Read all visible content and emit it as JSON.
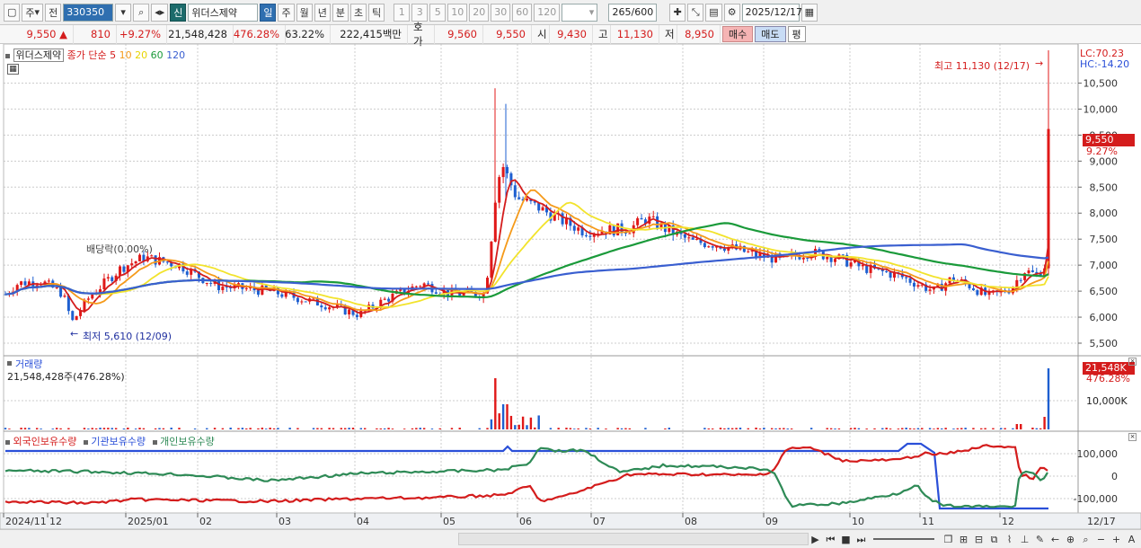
{
  "toolbar": {
    "market": "주",
    "prev": "전",
    "code": "330350",
    "name_badge": "신",
    "name": "위더스제약",
    "periods": [
      "일",
      "주",
      "월",
      "년",
      "분",
      "초",
      "틱"
    ],
    "intervals": [
      "1",
      "3",
      "5",
      "10",
      "20",
      "30",
      "60",
      "120"
    ],
    "count": "265",
    "count_total": "/600",
    "date": "2025/12/17"
  },
  "quote": {
    "price": "9,550",
    "change": "810",
    "change_pct": "+9.27%",
    "volume": "21,548,428",
    "vol_ratio": "476.28%",
    "turnover": "63.22%",
    "amount": "222,415백만",
    "bid_label": "호가",
    "ask": "9,560",
    "bid": "9,550",
    "open_label": "시",
    "open": "9,430",
    "high_label": "고",
    "high": "11,130",
    "low_label": "저",
    "low": "8,950",
    "buy": "매수",
    "sell": "매도",
    "eval": "평"
  },
  "legend": {
    "stock": "위더스제약",
    "ma_label": "종가 단순",
    "ma": [
      {
        "p": "5",
        "color": "#d41c1c"
      },
      {
        "p": "10",
        "color": "#f59a1a"
      },
      {
        "p": "20",
        "color": "#f2e32c"
      },
      {
        "p": "60",
        "color": "#1a9a3a"
      },
      {
        "p": "120",
        "color": "#3a5fd0"
      }
    ]
  },
  "annotations": {
    "high": "최고 11,130 (12/17)",
    "low": "최저 5,610 (12/09)",
    "dividend": "배당락(0.00%)",
    "lc": "LC:70.23",
    "hc": "HC:-14.20",
    "cur_price": "9,550",
    "cur_pct": "9.27%"
  },
  "volume_panel": {
    "title": "거래량",
    "value": "21,548,428주(476.28%)",
    "tag": "21,548K",
    "tag_pct": "476.28%",
    "axis": "10,000K"
  },
  "holdings_panel": {
    "legends": [
      {
        "label": "외국인보유수량",
        "color": "#d41c1c"
      },
      {
        "label": "기관보유수량",
        "color": "#2a4fd8"
      },
      {
        "label": "개인보유수량",
        "color": "#2e8a56"
      }
    ],
    "axis": [
      "100,000",
      "0",
      "-100,000"
    ]
  },
  "price_axis": [
    "10,500",
    "10,000",
    "9,500",
    "9,000",
    "8,500",
    "8,000",
    "7,500",
    "7,000",
    "6,500",
    "6,000",
    "5,500"
  ],
  "date_axis": [
    "2024/11",
    "12",
    "2025/01",
    "02",
    "03",
    "04",
    "05",
    "06",
    "07",
    "08",
    "09",
    "10",
    "11",
    "12"
  ],
  "date_axis_right": "12/17",
  "chart_data": [
    {
      "type": "line",
      "title": "",
      "description": "Daily candlestick price with simple moving averages",
      "ylim": [
        5300,
        11130
      ],
      "series": [
        {
          "name": "5",
          "color": "#d41c1c"
        },
        {
          "name": "10",
          "color": "#f59a1a"
        },
        {
          "name": "20",
          "color": "#f2e32c"
        },
        {
          "name": "60",
          "color": "#1a9a3a"
        },
        {
          "name": "120",
          "color": "#3a5fd0"
        }
      ],
      "x": [
        "2024/11",
        "12",
        "2025/01",
        "02",
        "03",
        "04",
        "05",
        "06",
        "07",
        "08",
        "09",
        "10",
        "11",
        "12",
        "12/17"
      ],
      "close_approx": [
        6600,
        6700,
        7000,
        6550,
        6300,
        6050,
        6500,
        8200,
        7600,
        7450,
        7100,
        6900,
        6600,
        6700,
        9550
      ]
    }
  ]
}
